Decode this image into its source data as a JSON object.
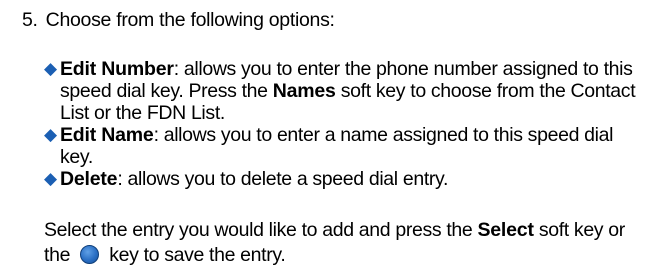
{
  "step": {
    "number": "5.",
    "text": "Choose from the following options:"
  },
  "options": [
    {
      "term": "Edit Number",
      "text_before_key": ": allows you to enter the phone number assigned to this speed dial key. Press the ",
      "softkey": "Names",
      "text_after_key": " soft key to choose from the Contact List or the FDN List."
    },
    {
      "term": "Edit Name",
      "text": ": allows you to enter a name assigned to this speed dial key."
    },
    {
      "term": "Delete",
      "text": ": allows you to delete a speed dial entry."
    }
  ],
  "closing": {
    "text_before_key": "Select the entry you would like to add and press the ",
    "softkey": "Select",
    "text_middle": " soft key or the ",
    "icon": "ok-key-icon",
    "text_after": " key to save the entry."
  },
  "colors": {
    "bullet": "#1b5fb3",
    "key_icon": "#2a6fc4",
    "text": "#000000"
  }
}
